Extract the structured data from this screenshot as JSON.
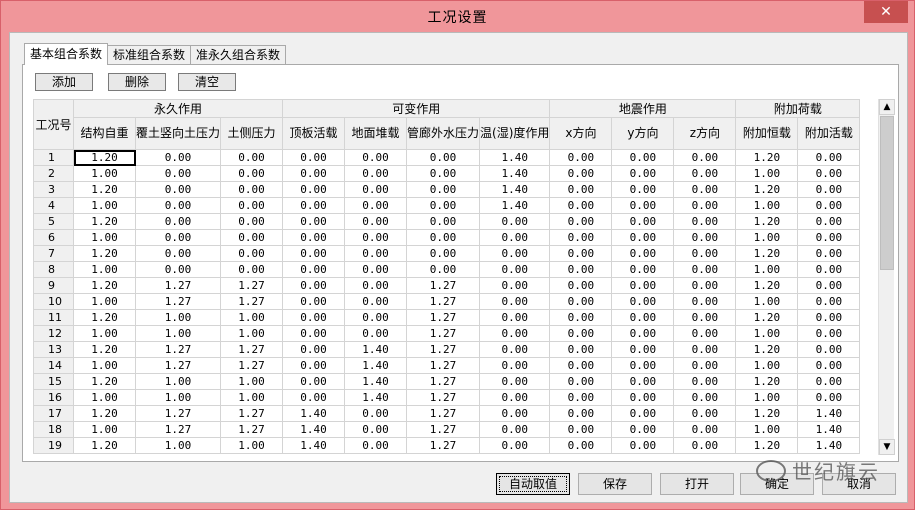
{
  "window": {
    "title": "工况设置",
    "close_glyph": "✕"
  },
  "tabs": [
    {
      "label": "基本组合系数",
      "active": true
    },
    {
      "label": "标准组合系数",
      "active": false
    },
    {
      "label": "准永久组合系数",
      "active": false
    }
  ],
  "toolbar": {
    "add_label": "添加",
    "delete_label": "删除",
    "clear_label": "清空"
  },
  "grid": {
    "row_header": "工况号",
    "groups": [
      "永久作用",
      "可变作用",
      "地震作用",
      "附加荷载"
    ],
    "columns": [
      "结构自重",
      "覆土竖向土压力",
      "土侧压力",
      "顶板活载",
      "地面堆载",
      "管廊外水压力",
      "温(湿)度作用",
      "x方向",
      "y方向",
      "z方向",
      "附加恒载",
      "附加活载"
    ],
    "rows": [
      {
        "id": "1",
        "v": [
          "1.20",
          "0.00",
          "0.00",
          "0.00",
          "0.00",
          "0.00",
          "1.40",
          "0.00",
          "0.00",
          "0.00",
          "1.20",
          "0.00"
        ]
      },
      {
        "id": "2",
        "v": [
          "1.00",
          "0.00",
          "0.00",
          "0.00",
          "0.00",
          "0.00",
          "1.40",
          "0.00",
          "0.00",
          "0.00",
          "1.00",
          "0.00"
        ]
      },
      {
        "id": "3",
        "v": [
          "1.20",
          "0.00",
          "0.00",
          "0.00",
          "0.00",
          "0.00",
          "1.40",
          "0.00",
          "0.00",
          "0.00",
          "1.20",
          "0.00"
        ]
      },
      {
        "id": "4",
        "v": [
          "1.00",
          "0.00",
          "0.00",
          "0.00",
          "0.00",
          "0.00",
          "1.40",
          "0.00",
          "0.00",
          "0.00",
          "1.00",
          "0.00"
        ]
      },
      {
        "id": "5",
        "v": [
          "1.20",
          "0.00",
          "0.00",
          "0.00",
          "0.00",
          "0.00",
          "0.00",
          "0.00",
          "0.00",
          "0.00",
          "1.20",
          "0.00"
        ]
      },
      {
        "id": "6",
        "v": [
          "1.00",
          "0.00",
          "0.00",
          "0.00",
          "0.00",
          "0.00",
          "0.00",
          "0.00",
          "0.00",
          "0.00",
          "1.00",
          "0.00"
        ]
      },
      {
        "id": "7",
        "v": [
          "1.20",
          "0.00",
          "0.00",
          "0.00",
          "0.00",
          "0.00",
          "0.00",
          "0.00",
          "0.00",
          "0.00",
          "1.20",
          "0.00"
        ]
      },
      {
        "id": "8",
        "v": [
          "1.00",
          "0.00",
          "0.00",
          "0.00",
          "0.00",
          "0.00",
          "0.00",
          "0.00",
          "0.00",
          "0.00",
          "1.00",
          "0.00"
        ]
      },
      {
        "id": "9",
        "v": [
          "1.20",
          "1.27",
          "1.27",
          "0.00",
          "0.00",
          "1.27",
          "0.00",
          "0.00",
          "0.00",
          "0.00",
          "1.20",
          "0.00"
        ]
      },
      {
        "id": "10",
        "v": [
          "1.00",
          "1.27",
          "1.27",
          "0.00",
          "0.00",
          "1.27",
          "0.00",
          "0.00",
          "0.00",
          "0.00",
          "1.00",
          "0.00"
        ]
      },
      {
        "id": "11",
        "v": [
          "1.20",
          "1.00",
          "1.00",
          "0.00",
          "0.00",
          "1.27",
          "0.00",
          "0.00",
          "0.00",
          "0.00",
          "1.20",
          "0.00"
        ]
      },
      {
        "id": "12",
        "v": [
          "1.00",
          "1.00",
          "1.00",
          "0.00",
          "0.00",
          "1.27",
          "0.00",
          "0.00",
          "0.00",
          "0.00",
          "1.00",
          "0.00"
        ]
      },
      {
        "id": "13",
        "v": [
          "1.20",
          "1.27",
          "1.27",
          "0.00",
          "1.40",
          "1.27",
          "0.00",
          "0.00",
          "0.00",
          "0.00",
          "1.20",
          "0.00"
        ]
      },
      {
        "id": "14",
        "v": [
          "1.00",
          "1.27",
          "1.27",
          "0.00",
          "1.40",
          "1.27",
          "0.00",
          "0.00",
          "0.00",
          "0.00",
          "1.00",
          "0.00"
        ]
      },
      {
        "id": "15",
        "v": [
          "1.20",
          "1.00",
          "1.00",
          "0.00",
          "1.40",
          "1.27",
          "0.00",
          "0.00",
          "0.00",
          "0.00",
          "1.20",
          "0.00"
        ]
      },
      {
        "id": "16",
        "v": [
          "1.00",
          "1.00",
          "1.00",
          "0.00",
          "1.40",
          "1.27",
          "0.00",
          "0.00",
          "0.00",
          "0.00",
          "1.00",
          "0.00"
        ]
      },
      {
        "id": "17",
        "v": [
          "1.20",
          "1.27",
          "1.27",
          "1.40",
          "0.00",
          "1.27",
          "0.00",
          "0.00",
          "0.00",
          "0.00",
          "1.20",
          "1.40"
        ]
      },
      {
        "id": "18",
        "v": [
          "1.00",
          "1.27",
          "1.27",
          "1.40",
          "0.00",
          "1.27",
          "0.00",
          "0.00",
          "0.00",
          "0.00",
          "1.00",
          "1.40"
        ]
      },
      {
        "id": "19",
        "v": [
          "1.20",
          "1.00",
          "1.00",
          "1.40",
          "0.00",
          "1.27",
          "0.00",
          "0.00",
          "0.00",
          "0.00",
          "1.20",
          "1.40"
        ]
      }
    ]
  },
  "buttons": {
    "auto_label": "自动取值",
    "save_label": "保存",
    "open_label": "打开",
    "ok_label": "确定",
    "cancel_label": "取消"
  },
  "watermark": {
    "text": "世纪旗云"
  },
  "colors": {
    "titlebar": "#f0969a",
    "close": "#c75050"
  }
}
